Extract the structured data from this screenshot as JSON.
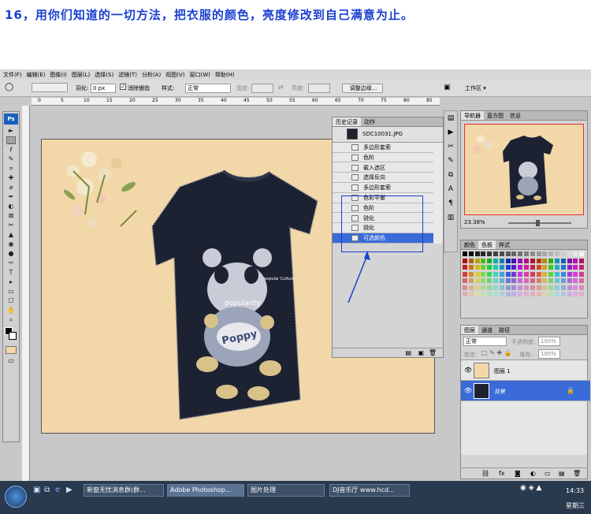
{
  "caption": "16，用你们知道的一切方法，把衣服的颜色，亮度修改到自己满意为止。",
  "menu": [
    "文件(F)",
    "编辑(E)",
    "图像(I)",
    "图层(L)",
    "选择(S)",
    "滤镜(T)",
    "分析(A)",
    "视图(V)",
    "窗口(W)",
    "帮助(H)"
  ],
  "options": {
    "feather_label": "羽化:",
    "feather_value": "0 px",
    "antialias_label": "消除锯齿",
    "style_label": "样式:",
    "style_value": "正常",
    "width_label": "宽度:",
    "height_label": "高度:",
    "refine_button": "调整边缘...",
    "workspace_label": "工作区 ▾"
  },
  "ruler_ticks": [
    "0",
    "5",
    "10",
    "15",
    "20",
    "25",
    "30",
    "35",
    "40",
    "45",
    "50",
    "55",
    "60",
    "65",
    "70",
    "75",
    "80",
    "85"
  ],
  "tools": [
    "►",
    "⬚",
    "ℓ",
    "✎",
    "⌗",
    "✚",
    "⌀",
    "✒",
    "◐",
    "⊠",
    "✂",
    "▲",
    "◉",
    "●",
    "✑",
    "T",
    "▸",
    "▭",
    "☐",
    "✋",
    "⌕"
  ],
  "canvas_print": {
    "text_top": "popularity",
    "text_logo": "Poppy",
    "text_small": "popular Culture"
  },
  "history": {
    "tabs": [
      "历史记录",
      "动作"
    ],
    "snapshot": "SDC10031.JPG",
    "items": [
      "多边形套索",
      "色阶",
      "载入选区",
      "选择反向",
      "多边形套索",
      "色彩平衡",
      "色阶",
      "锐化",
      "锐化",
      "可选颜色"
    ],
    "selected_index": 9
  },
  "navigator": {
    "tabs": [
      "导航器",
      "直方图",
      "信息"
    ],
    "zoom": "23.38%"
  },
  "swatches": {
    "tabs": [
      "颜色",
      "色板",
      "样式"
    ]
  },
  "layers": {
    "tabs": [
      "图层",
      "通道",
      "路径"
    ],
    "blend_mode": "正常",
    "opacity_label": "不透明度:",
    "opacity_value": "100%",
    "lock_label": "锁定:",
    "fill_label": "填充:",
    "fill_value": "100%",
    "items": [
      {
        "name": "图层 1"
      },
      {
        "name": "背景"
      }
    ]
  },
  "taskbar": {
    "tasks": [
      "新窗无忧消息群(群...",
      "Adobe Photoshop...",
      "图片处理",
      "DJ音乐厅 www.hcd..."
    ],
    "time": "14:33",
    "day": "星期三"
  },
  "colors": {
    "accent": "#3a6bd8",
    "annotation": "#1a3fd0",
    "canvas_bg": "#f2d7a8",
    "shirt": "#1d2233"
  }
}
